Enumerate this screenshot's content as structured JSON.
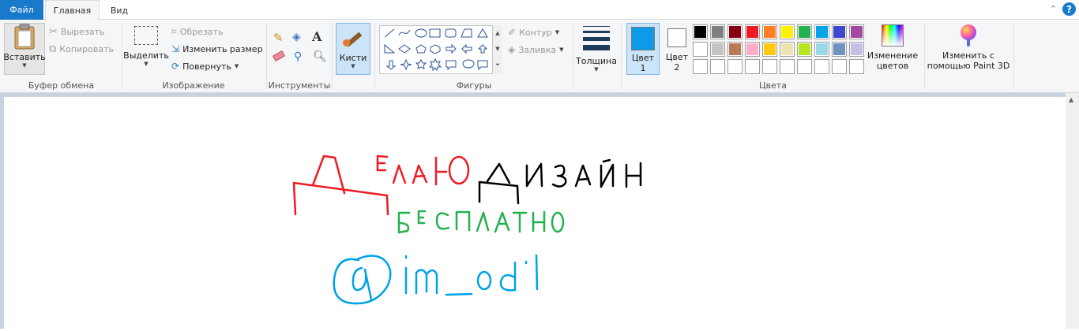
{
  "tabs": {
    "file": "Файл",
    "home": "Главная",
    "view": "Вид",
    "help": "?"
  },
  "clipboard": {
    "paste": "Вставить",
    "cut": "Вырезать",
    "copy": "Копировать",
    "label": "Буфер обмена"
  },
  "image": {
    "select": "Выделить",
    "crop": "Обрезать",
    "resize": "Изменить размер",
    "rotate": "Повернуть",
    "label": "Изображение"
  },
  "tools": {
    "label": "Инструменты"
  },
  "brushes": {
    "label": "Кисти"
  },
  "shapes": {
    "outline": "Контур",
    "fill": "Заливка",
    "label": "Фигуры"
  },
  "size": {
    "label": "Толщина"
  },
  "colors": {
    "color1": "Цвет",
    "color1_num": "1",
    "color2": "Цвет",
    "color2_num": "2",
    "edit_colors_line1": "Изменение",
    "edit_colors_line2": "цветов",
    "paint3d_line1": "Изменить с",
    "paint3d_line2": "помощью Paint 3D",
    "label": "Цвета",
    "color1_value": "#0d9be8",
    "color2_value": "#ffffff",
    "palette_row1": [
      "#000000",
      "#7f7f7f",
      "#880015",
      "#ed1c24",
      "#ff7f27",
      "#fff200",
      "#22b14c",
      "#00a2e8",
      "#3f48cc",
      "#a349a4"
    ],
    "palette_row2": [
      "#ffffff",
      "#c3c3c3",
      "#b97a57",
      "#ffaec9",
      "#ffc90e",
      "#efe4b0",
      "#b5e61d",
      "#99d9ea",
      "#7092be",
      "#c8bfe7"
    ],
    "palette_row3": [
      "#ffffff",
      "#ffffff",
      "#ffffff",
      "#ffffff",
      "#ffffff",
      "#ffffff",
      "#ffffff",
      "#ffffff",
      "#ffffff",
      "#ffffff"
    ]
  },
  "drawing": {
    "line1_red": "ДЕЛАЮ",
    "line1_black": "ДИЗАЙН",
    "line2_green": "БЕСПЛАТНО",
    "line3_blue": "@im_odi"
  }
}
